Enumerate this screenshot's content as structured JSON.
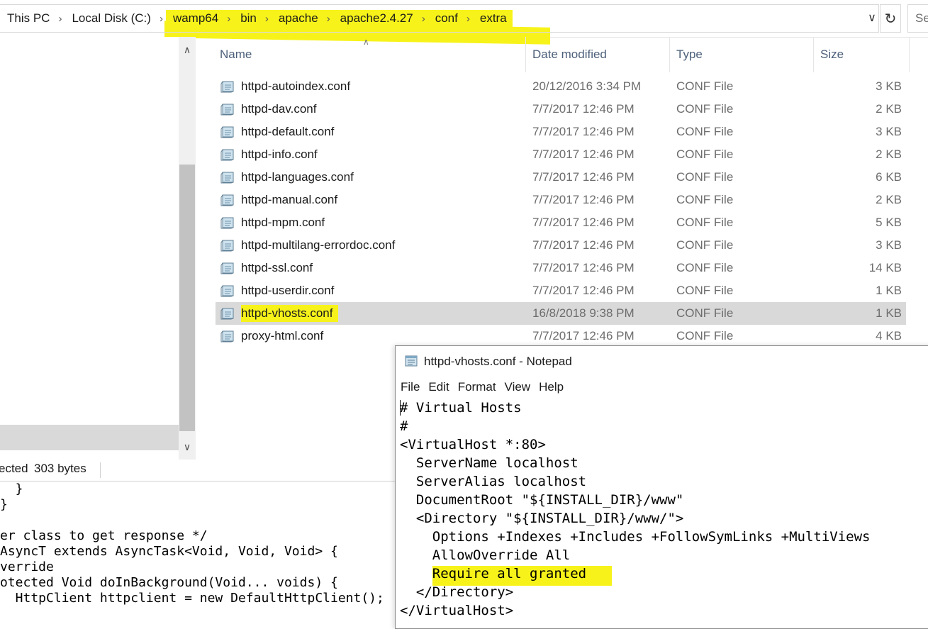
{
  "address_bar": {
    "crumbs": [
      {
        "label": "This PC",
        "highlight": false
      },
      {
        "label": "Local Disk (C:)",
        "highlight": false
      },
      {
        "label": "wamp64",
        "highlight": true
      },
      {
        "label": "bin",
        "highlight": true
      },
      {
        "label": "apache",
        "highlight": true
      },
      {
        "label": "apache2.4.27",
        "highlight": true
      },
      {
        "label": "conf",
        "highlight": true
      },
      {
        "label": "extra",
        "highlight": true
      }
    ],
    "dropdown_icon": "chevron-down-icon",
    "refresh_icon": "refresh-icon",
    "search_placeholder": "Se"
  },
  "file_list": {
    "columns": {
      "name": "Name",
      "date": "Date modified",
      "type": "Type",
      "size": "Size"
    },
    "files": [
      {
        "name": "httpd-autoindex.conf",
        "date": "20/12/2016 3:34 PM",
        "type": "CONF File",
        "size": "3 KB"
      },
      {
        "name": "httpd-dav.conf",
        "date": "7/7/2017 12:46 PM",
        "type": "CONF File",
        "size": "2 KB"
      },
      {
        "name": "httpd-default.conf",
        "date": "7/7/2017 12:46 PM",
        "type": "CONF File",
        "size": "3 KB"
      },
      {
        "name": "httpd-info.conf",
        "date": "7/7/2017 12:46 PM",
        "type": "CONF File",
        "size": "2 KB"
      },
      {
        "name": "httpd-languages.conf",
        "date": "7/7/2017 12:46 PM",
        "type": "CONF File",
        "size": "6 KB"
      },
      {
        "name": "httpd-manual.conf",
        "date": "7/7/2017 12:46 PM",
        "type": "CONF File",
        "size": "2 KB"
      },
      {
        "name": "httpd-mpm.conf",
        "date": "7/7/2017 12:46 PM",
        "type": "CONF File",
        "size": "5 KB"
      },
      {
        "name": "httpd-multilang-errordoc.conf",
        "date": "7/7/2017 12:46 PM",
        "type": "CONF File",
        "size": "3 KB"
      },
      {
        "name": "httpd-ssl.conf",
        "date": "7/7/2017 12:46 PM",
        "type": "CONF File",
        "size": "14 KB"
      },
      {
        "name": "httpd-userdir.conf",
        "date": "7/7/2017 12:46 PM",
        "type": "CONF File",
        "size": "1 KB"
      },
      {
        "name": "httpd-vhosts.conf",
        "date": "16/8/2018 9:38 PM",
        "type": "CONF File",
        "size": "1 KB",
        "selected": true
      },
      {
        "name": "proxy-html.conf",
        "date": "7/7/2017 12:46 PM",
        "type": "CONF File",
        "size": "4 KB"
      }
    ]
  },
  "status_bar": {
    "selected_text": "ected",
    "size_text": "303 bytes"
  },
  "code_background": {
    "lines": [
      "  }",
      "}",
      "",
      "er class to get response */",
      "AsyncT extends AsyncTask<Void, Void, Void> {",
      "verride",
      "otected Void doInBackground(Void... voids) {",
      "  HttpClient httpclient = new DefaultHttpClient();"
    ]
  },
  "notepad": {
    "title": "httpd-vhosts.conf - Notepad",
    "menu": [
      "File",
      "Edit",
      "Format",
      "View",
      "Help"
    ],
    "lines": [
      "# Virtual Hosts",
      "#",
      "<VirtualHost *:80>",
      "  ServerName localhost",
      "  ServerAlias localhost",
      "  DocumentRoot \"${INSTALL_DIR}/www\"",
      "  <Directory \"${INSTALL_DIR}/www/\">",
      "    Options +Indexes +Includes +FollowSymLinks +MultiViews",
      "    AllowOverride All",
      "    Require all granted",
      "  </Directory>",
      "</VirtualHost>"
    ],
    "highlighted_line": "Require all granted"
  },
  "colors": {
    "highlight": "#f7f31a",
    "selected_row": "#d9d9d9",
    "header_text": "#4c607a"
  }
}
